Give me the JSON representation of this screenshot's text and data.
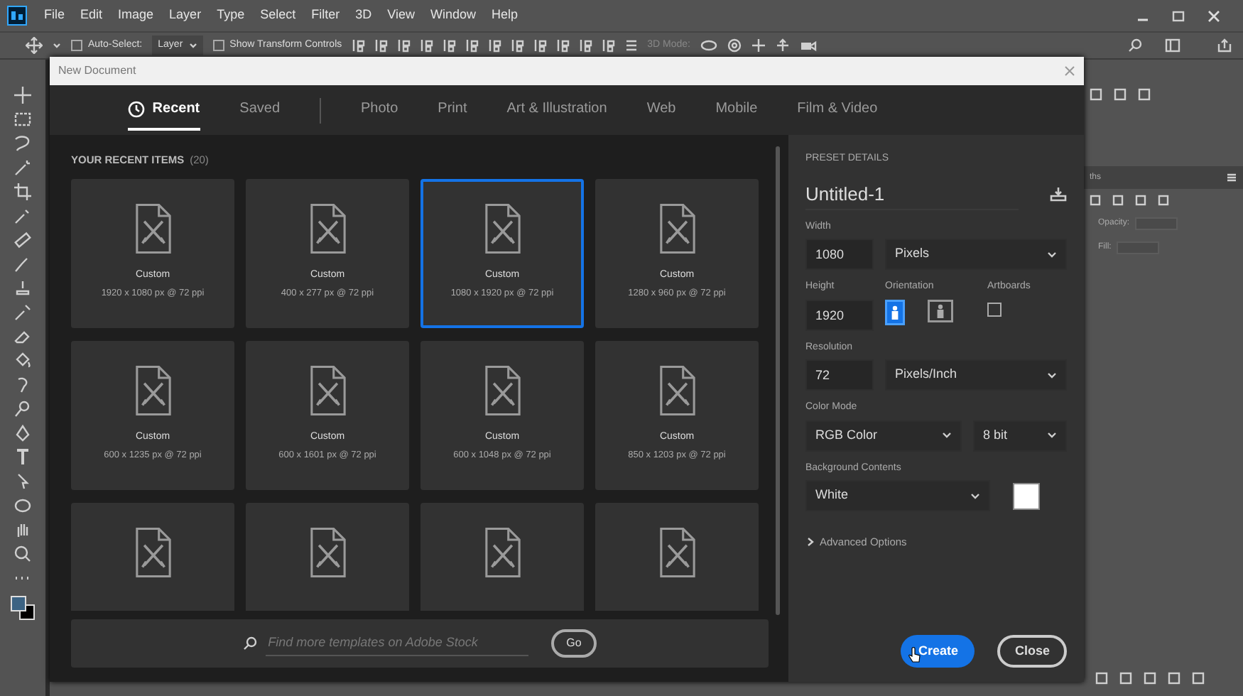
{
  "menu": [
    "File",
    "Edit",
    "Image",
    "Layer",
    "Type",
    "Select",
    "Filter",
    "3D",
    "View",
    "Window",
    "Help"
  ],
  "options_bar": {
    "auto_select": {
      "label": "Auto-Select:",
      "checked": false
    },
    "layer_dropdown": "Layer",
    "transform_controls": {
      "label": "Show Transform Controls",
      "checked": false
    },
    "mode_label": "3D Mode:"
  },
  "dialog": {
    "title": "New Document",
    "tabs": [
      {
        "label": "Recent",
        "divider_before": false,
        "selected": true
      },
      {
        "label": "Saved",
        "divider_before": false,
        "selected": false
      },
      {
        "label": "Photo",
        "divider_before": true,
        "selected": false
      },
      {
        "label": "Print",
        "divider_before": false,
        "selected": false
      },
      {
        "label": "Art & Illustration",
        "divider_before": false,
        "selected": false
      },
      {
        "label": "Web",
        "divider_before": false,
        "selected": false
      },
      {
        "label": "Mobile",
        "divider_before": false,
        "selected": false
      },
      {
        "label": "Film & Video",
        "divider_before": false,
        "selected": false
      }
    ],
    "recent": {
      "heading": "YOUR RECENT ITEMS",
      "count": "(20)",
      "items": [
        {
          "name": "Custom",
          "size": "1920 x 1080 px @ 72 ppi",
          "selected": false
        },
        {
          "name": "Custom",
          "size": "400 x 277 px @ 72 ppi",
          "selected": false
        },
        {
          "name": "Custom",
          "size": "1080 x 1920 px @ 72 ppi",
          "selected": true
        },
        {
          "name": "Custom",
          "size": "1280 x 960 px @ 72 ppi",
          "selected": false
        },
        {
          "name": "Custom",
          "size": "600 x 1235 px @ 72 ppi",
          "selected": false
        },
        {
          "name": "Custom",
          "size": "600 x 1601 px @ 72 ppi",
          "selected": false
        },
        {
          "name": "Custom",
          "size": "600 x 1048 px @ 72 ppi",
          "selected": false
        },
        {
          "name": "Custom",
          "size": "850 x 1203 px @ 72 ppi",
          "selected": false
        },
        {
          "selected": false
        },
        {
          "selected": false
        },
        {
          "selected": false
        },
        {
          "selected": false
        }
      ]
    },
    "search": {
      "placeholder": "Find more templates on Adobe Stock",
      "button": "Go"
    },
    "preset": {
      "heading": "PRESET DETAILS",
      "name": "Untitled-1",
      "width": {
        "label": "Width",
        "value": "1080",
        "unit": "Pixels"
      },
      "height": {
        "label": "Height",
        "value": "1920"
      },
      "orientation": {
        "label": "Orientation",
        "options": [
          {
            "kind": "portrait",
            "selected": true
          },
          {
            "kind": "landscape",
            "selected": false
          }
        ]
      },
      "artboards": {
        "label": "Artboards",
        "checked": false
      },
      "resolution": {
        "label": "Resolution",
        "value": "72",
        "unit": "Pixels/Inch"
      },
      "color_mode": {
        "label": "Color Mode",
        "mode": "RGB Color",
        "depth": "8 bit"
      },
      "background": {
        "label": "Background Contents",
        "value": "White",
        "color": "#ffffff"
      },
      "advanced": {
        "label": "Advanced Options",
        "expanded": false
      }
    },
    "buttons": [
      {
        "label": "Create",
        "kind": "primary"
      },
      {
        "label": "Close",
        "kind": "secondary"
      }
    ]
  },
  "panels": {
    "tab": "ths",
    "opacity_label": "Opacity:",
    "fill_label": "Fill:"
  }
}
